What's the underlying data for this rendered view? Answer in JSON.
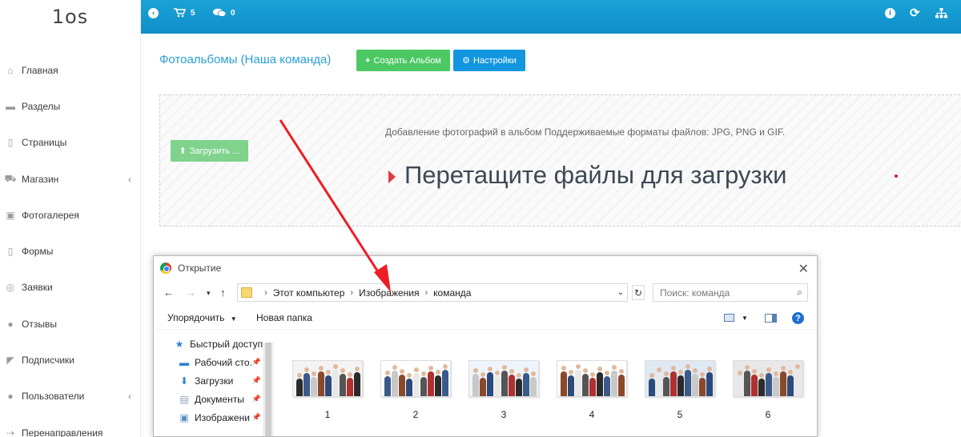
{
  "logo": {
    "text": "1os"
  },
  "sidebar": {
    "items": [
      {
        "label": "Главная",
        "icon": "home-icon",
        "glyph": "⌂"
      },
      {
        "label": "Разделы",
        "icon": "folder-icon",
        "glyph": "▬"
      },
      {
        "label": "Страницы",
        "icon": "file-icon",
        "glyph": "▯"
      },
      {
        "label": "Магазин",
        "icon": "cart-icon",
        "glyph": "⛟",
        "chevron": "‹"
      },
      {
        "label": "Фотогалерея",
        "icon": "picture-icon",
        "glyph": "▣"
      },
      {
        "label": "Формы",
        "icon": "form-icon",
        "glyph": "▯"
      },
      {
        "label": "Заявки",
        "icon": "target-icon",
        "glyph": "◎"
      },
      {
        "label": "Отзывы",
        "icon": "comments-icon",
        "glyph": "●"
      },
      {
        "label": "Подписчики",
        "icon": "bullhorn-icon",
        "glyph": "◤"
      },
      {
        "label": "Пользователи",
        "icon": "users-icon",
        "glyph": "●",
        "chevron": "‹"
      },
      {
        "label": "Перенаправления",
        "icon": "redirect-icon",
        "glyph": "⇢"
      }
    ]
  },
  "topbar": {
    "cart_count": "5",
    "comments_count": "0",
    "accent": "#1aa3d6"
  },
  "page": {
    "title": "Фотоальбомы (Наша команда)",
    "create_album_label": "Создать Альбом",
    "settings_label": "Настройки"
  },
  "dropzone": {
    "upload_label": "Загрузить ...",
    "description": "Добавление фотографий в альбом Поддерживаемые форматы файлов: JPG, PNG и GIF.",
    "drop_text": "Перетащите файлы для загрузки"
  },
  "dialog": {
    "title": "Открытие",
    "breadcrumb": [
      "Этот компьютер",
      "Изображения",
      "команда"
    ],
    "search_placeholder": "Поиск: команда",
    "organize_label": "Упорядочить",
    "new_folder_label": "Новая папка",
    "tree": [
      {
        "label": "Быстрый доступ",
        "icon": "star-icon",
        "pinned": false
      },
      {
        "label": "Рабочий сто.",
        "icon": "desktop-icon",
        "pinned": true
      },
      {
        "label": "Загрузки",
        "icon": "download-icon",
        "pinned": true
      },
      {
        "label": "Документы",
        "icon": "documents-icon",
        "pinned": true
      },
      {
        "label": "Изображени",
        "icon": "images-icon",
        "pinned": true
      }
    ],
    "files": [
      "1",
      "2",
      "3",
      "4",
      "5",
      "6"
    ]
  }
}
